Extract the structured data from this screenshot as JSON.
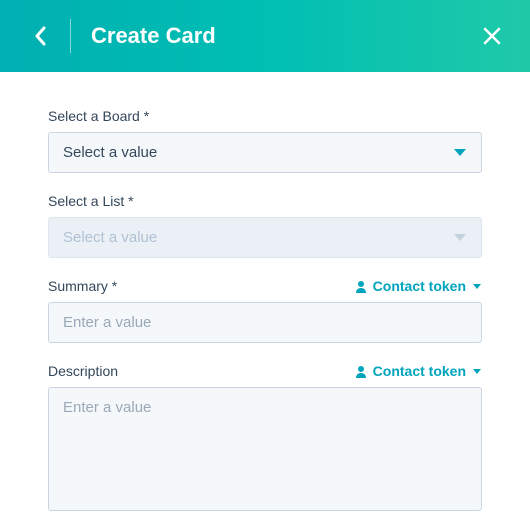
{
  "header": {
    "title": "Create Card"
  },
  "form": {
    "board": {
      "label": "Select a Board *",
      "value": "Select a value"
    },
    "list": {
      "label": "Select a List *",
      "value": "Select a value"
    },
    "summary": {
      "label": "Summary *",
      "placeholder": "Enter a value",
      "token_label": "Contact token"
    },
    "description": {
      "label": "Description",
      "placeholder": "Enter a value",
      "token_label": "Contact token"
    }
  },
  "colors": {
    "header_gradient_start": "#00afb2",
    "header_gradient_end": "#1fc9a8",
    "accent": "#00a4bd",
    "text_primary": "#33475b",
    "input_bg": "#f5f8fa",
    "input_border": "#cbd6e2"
  }
}
